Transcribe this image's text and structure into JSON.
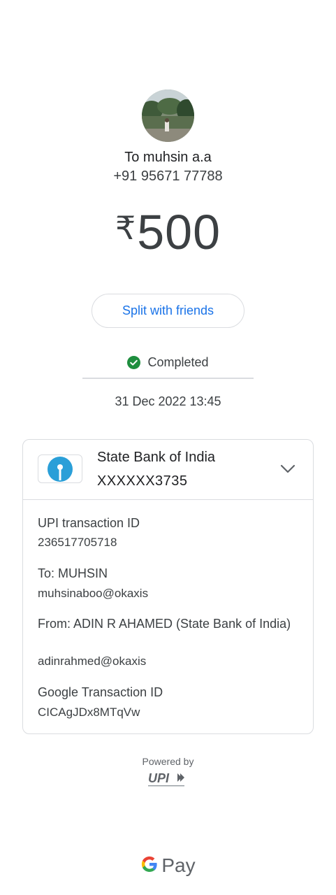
{
  "recipient": {
    "name": "To muhsin a.a",
    "phone": "+91 95671 77788"
  },
  "amount": {
    "currency": "₹",
    "value": "500"
  },
  "split_button": "Split with friends",
  "status": {
    "label": "Completed",
    "color": "#1e8e3e"
  },
  "datetime": "31 Dec 2022 13:45",
  "bank": {
    "name": "State Bank of India",
    "account": "XXXXXX3735",
    "logo_color": "#2a9fd8"
  },
  "details": {
    "upi_label": "UPI transaction ID",
    "upi_value": "236517705718",
    "to_label": "To: MUHSIN",
    "to_value": "muhsinaboo@okaxis",
    "from_label": "From: ADIN R AHAMED (State Bank of India)",
    "from_value": "adinrahmed@okaxis",
    "google_label": "Google Transaction ID",
    "google_value": "CICAgJDx8MTqVw"
  },
  "footer": {
    "powered_by": "Powered by",
    "upi_logo": "UPI",
    "brand": "Pay",
    "accent": "#1a73e8"
  }
}
